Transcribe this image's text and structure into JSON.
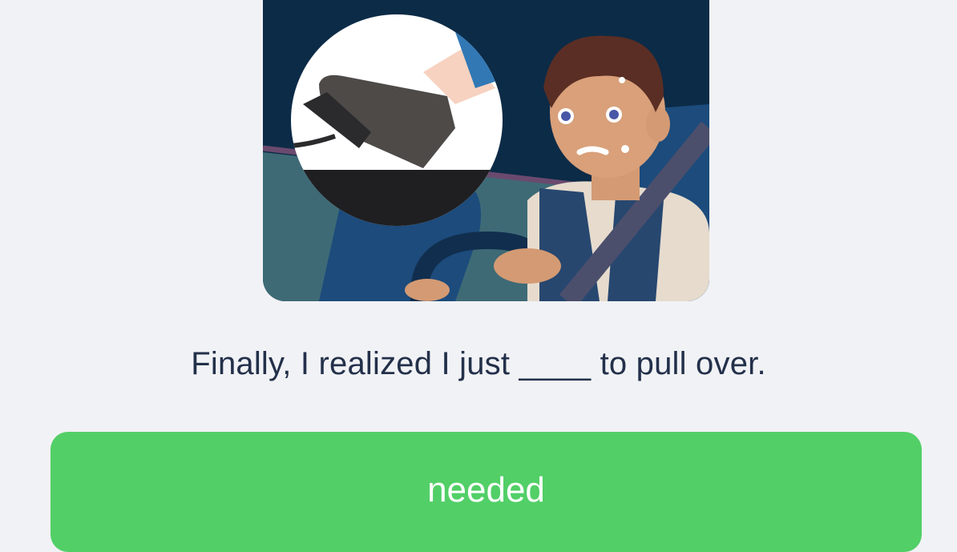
{
  "question": {
    "before_blank": "Finally, I realized I just ",
    "blank": "____",
    "after_blank": " to pull over."
  },
  "answer_button": {
    "label": "needed"
  },
  "colors": {
    "background": "#f1f2f5",
    "answer_green": "#52cf67",
    "text_dark": "#23304a",
    "scene_navy": "#0c2b47"
  }
}
